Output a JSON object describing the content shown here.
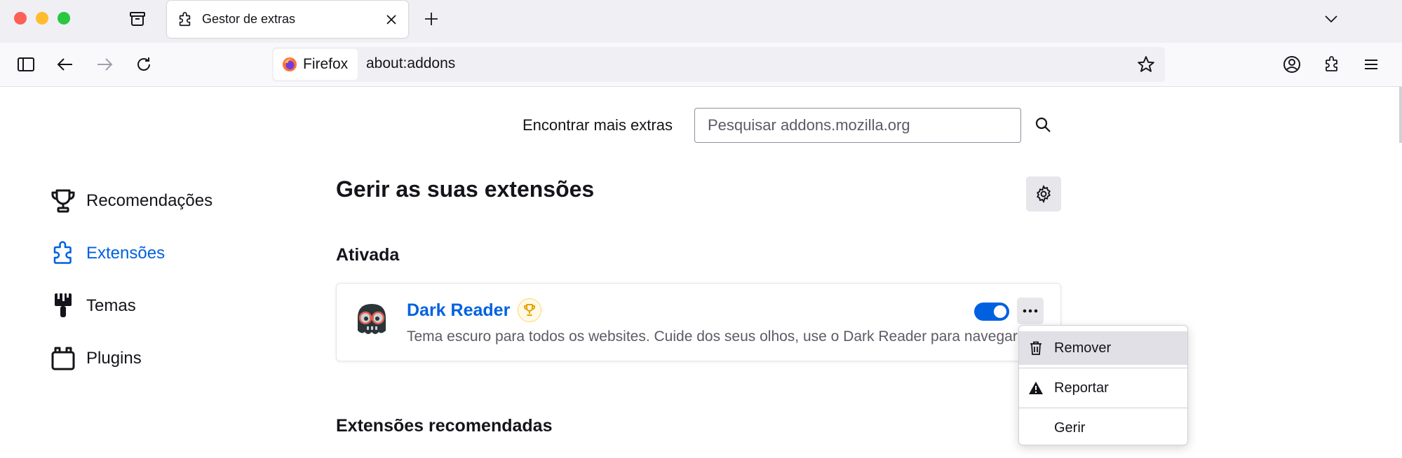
{
  "tab": {
    "title": "Gestor de extras"
  },
  "urlbar": {
    "identity_label": "Firefox",
    "url": "about:addons"
  },
  "search": {
    "label": "Encontrar mais extras",
    "placeholder": "Pesquisar addons.mozilla.org"
  },
  "sidebar": {
    "items": [
      {
        "label": "Recomendações",
        "icon": "trophy-icon",
        "active": false
      },
      {
        "label": "Extensões",
        "icon": "puzzle-icon",
        "active": true
      },
      {
        "label": "Temas",
        "icon": "paintbrush-icon",
        "active": false
      },
      {
        "label": "Plugins",
        "icon": "plugin-icon",
        "active": false
      }
    ]
  },
  "main": {
    "title": "Gerir as suas extensões",
    "enabled_section": "Ativada",
    "recommended_section": "Extensões recomendadas"
  },
  "addon": {
    "name": "Dark Reader",
    "description": "Tema escuro para todos os websites. Cuide dos seus olhos, use o Dark Reader para navegar à noite e durante o dia.",
    "enabled": true,
    "badge": "recommended-trophy-icon"
  },
  "menu": {
    "items": [
      {
        "label": "Remover",
        "icon": "trash-icon"
      },
      {
        "label": "Reportar",
        "icon": "warning-icon"
      },
      {
        "label": "Gerir",
        "icon": ""
      }
    ]
  },
  "colors": {
    "accent": "#0061e0",
    "text": "#15141a",
    "muted": "#5b5b66"
  }
}
